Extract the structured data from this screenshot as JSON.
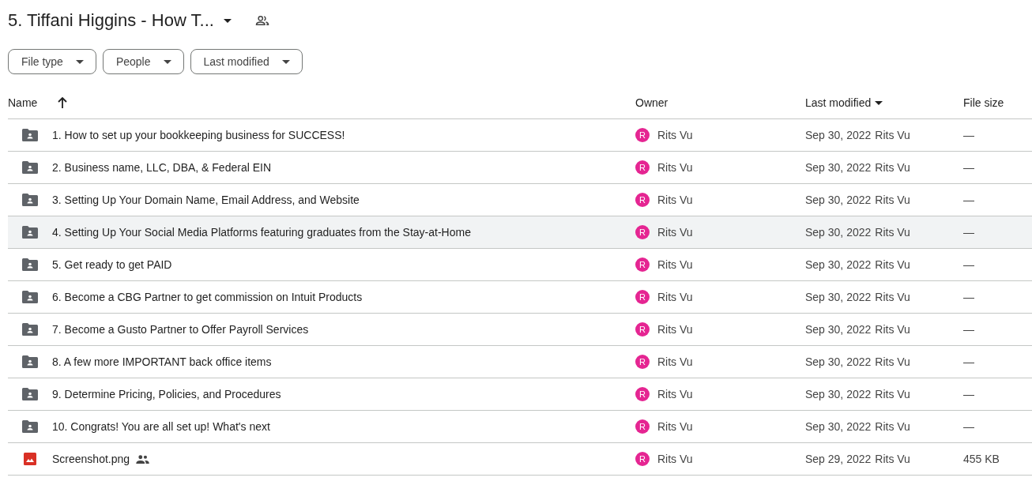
{
  "title": "5. Tiffani Higgins - How T...",
  "filters": [
    "File type",
    "People",
    "Last modified"
  ],
  "columns": [
    {
      "label": "Name",
      "kind": "sortup"
    },
    {
      "label": "Owner",
      "kind": "plain"
    },
    {
      "label": "Last modified",
      "kind": "sortdown"
    },
    {
      "label": "File size",
      "kind": "plain"
    }
  ],
  "rows": [
    {
      "kind": "folder",
      "name": "1. How to set up your bookkeeping business for SUCCESS!",
      "shared": false,
      "highlighted": false,
      "avatar": "R",
      "owner": "Rits Vu",
      "date": "Sep 30, 2022",
      "modifier": "Rits Vu",
      "size": "—"
    },
    {
      "kind": "folder",
      "name": "2. Business name, LLC, DBA, & Federal EIN",
      "shared": false,
      "highlighted": false,
      "avatar": "R",
      "owner": "Rits Vu",
      "date": "Sep 30, 2022",
      "modifier": "Rits Vu",
      "size": "—"
    },
    {
      "kind": "folder",
      "name": "3. Setting Up Your Domain Name, Email Address, and Website",
      "shared": false,
      "highlighted": false,
      "avatar": "R",
      "owner": "Rits Vu",
      "date": "Sep 30, 2022",
      "modifier": "Rits Vu",
      "size": "—"
    },
    {
      "kind": "folder",
      "name": "4. Setting Up Your Social Media Platforms featuring graduates from the Stay-at-Home",
      "shared": false,
      "highlighted": true,
      "avatar": "R",
      "owner": "Rits Vu",
      "date": "Sep 30, 2022",
      "modifier": "Rits Vu",
      "size": "—"
    },
    {
      "kind": "folder",
      "name": "5. Get ready to get PAID",
      "shared": false,
      "highlighted": false,
      "avatar": "R",
      "owner": "Rits Vu",
      "date": "Sep 30, 2022",
      "modifier": "Rits Vu",
      "size": "—"
    },
    {
      "kind": "folder",
      "name": "6. Become a CBG Partner to get commission on Intuit Products",
      "shared": false,
      "highlighted": false,
      "avatar": "R",
      "owner": "Rits Vu",
      "date": "Sep 30, 2022",
      "modifier": "Rits Vu",
      "size": "—"
    },
    {
      "kind": "folder",
      "name": "7. Become a Gusto Partner to Offer Payroll Services",
      "shared": false,
      "highlighted": false,
      "avatar": "R",
      "owner": "Rits Vu",
      "date": "Sep 30, 2022",
      "modifier": "Rits Vu",
      "size": "—"
    },
    {
      "kind": "folder",
      "name": "8. A few more IMPORTANT back office items",
      "shared": false,
      "highlighted": false,
      "avatar": "R",
      "owner": "Rits Vu",
      "date": "Sep 30, 2022",
      "modifier": "Rits Vu",
      "size": "—"
    },
    {
      "kind": "folder",
      "name": "9. Determine Pricing, Policies, and Procedures",
      "shared": false,
      "highlighted": false,
      "avatar": "R",
      "owner": "Rits Vu",
      "date": "Sep 30, 2022",
      "modifier": "Rits Vu",
      "size": "—"
    },
    {
      "kind": "folder",
      "name": "10. Congrats! You are all set up! What's next",
      "shared": false,
      "highlighted": false,
      "avatar": "R",
      "owner": "Rits Vu",
      "date": "Sep 30, 2022",
      "modifier": "Rits Vu",
      "size": "—"
    },
    {
      "kind": "image",
      "name": "Screenshot.png",
      "shared": true,
      "highlighted": false,
      "avatar": "R",
      "owner": "Rits Vu",
      "date": "Sep 29, 2022",
      "modifier": "Rits Vu",
      "size": "455 KB"
    }
  ]
}
